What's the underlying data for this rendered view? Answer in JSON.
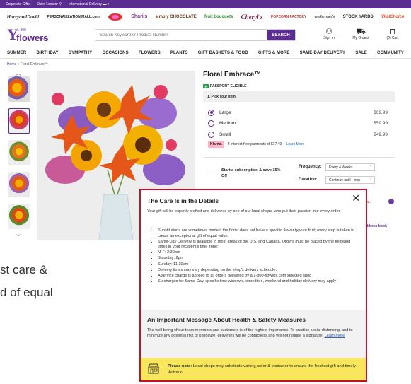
{
  "topbar": {
    "corporate": "Corporate Gifts",
    "store_locator": "Store Locator",
    "international": "International Delivery"
  },
  "brands": [
    "HarryandDavid",
    "PERSONALIZATION MALL.com",
    "Simply Chocolate? ",
    "Shari's",
    "simply CHOCOLATE",
    "fruit bouquets",
    "Cheryl's",
    "POPCORN FACTORY",
    "wolferman's",
    "STOCK YARDS",
    "VitalChoice"
  ],
  "header": {
    "logo_num": "1-800",
    "logo_word": "flowers",
    "logo_com": ".com",
    "search_placeholder": "Search Keyword or Product Number",
    "search_button": "SEARCH",
    "signin": "Sign In",
    "orders": "My Orders",
    "cart": "(0) Cart"
  },
  "nav": [
    "SUMMER",
    "BIRTHDAY",
    "SYMPATHY",
    "OCCASIONS",
    "FLOWERS",
    "PLANTS",
    "GIFT BASKETS & FOOD",
    "GIFTS & MORE",
    "SAME-DAY DELIVERY",
    "SALE",
    "COMMUNITY"
  ],
  "breadcrumb": {
    "home": "Home",
    "sep": " » ",
    "current": "Floral Embrace™"
  },
  "product": {
    "title": "Floral Embrace™",
    "passport": "PASSPORT ELIGIBLE",
    "pick_label": "1. Pick Your Item",
    "options": [
      {
        "label": "Large",
        "price": "$69.99",
        "selected": true
      },
      {
        "label": "Medium",
        "price": "$59.99",
        "selected": false
      },
      {
        "label": "Small",
        "price": "$49.99",
        "selected": false
      }
    ],
    "klarna_badge": "Klarna.",
    "klarna_text": "4 interest-free payments of $17.49.",
    "klarna_link": "Learn More",
    "subscription": "Start a subscription & save 15% Off",
    "frequency_label": "Frequency:",
    "frequency_value": "Every 4 Weeks",
    "duration_label": "Duration:",
    "duration_value": "Continue until I stop",
    "behind_year": "/Year.",
    "behind_address": "r address book"
  },
  "cropped": {
    "line1": "st care &",
    "line2": "d of equal"
  },
  "modal": {
    "title": "The Care Is in the Details",
    "intro": "Your gift will be expertly crafted and delivered by one of our local shops, who put their passion into every order.",
    "bullets": [
      "Substitutions are sometimes made if the florist does not have a specific flower type or fruit; every step is taken to create an exceptional gift of equal value.",
      "Same-Day Delivery is available in most areas of the U.S. and Canada. Orders must be placed by the following times in your recipient's time zone:",
      "M-F: 2:30pm",
      "Saturday: 2pm",
      "Sunday: 11:30am",
      "Delivery times may vary depending on the shop's delivery schedule.",
      "A service charge is applied to all orders delivered by a 1-800-flowers.com selected shop",
      "Surcharges for Same-Day, specific time windows, expedited, weekend and holiday delivery may apply"
    ],
    "health_title": "An Important Message About Health & Safety Measures",
    "health_text": "The well-being of our team members and customers is of the highest importance. To practice social distancing, and to minimize any potential risk of exposure, deliveries will be contactless and will not require a signature.",
    "health_link": "Learn more",
    "note_label": "Please note:",
    "note_text": " Local shops may substitute variety, color & container to ensure the freshest gift and timely delivery.",
    "close": "✕"
  },
  "colors": {
    "brand_purple": "#5c2d91",
    "modal_border": "#c8102e",
    "note_yellow": "#f8e65c"
  }
}
